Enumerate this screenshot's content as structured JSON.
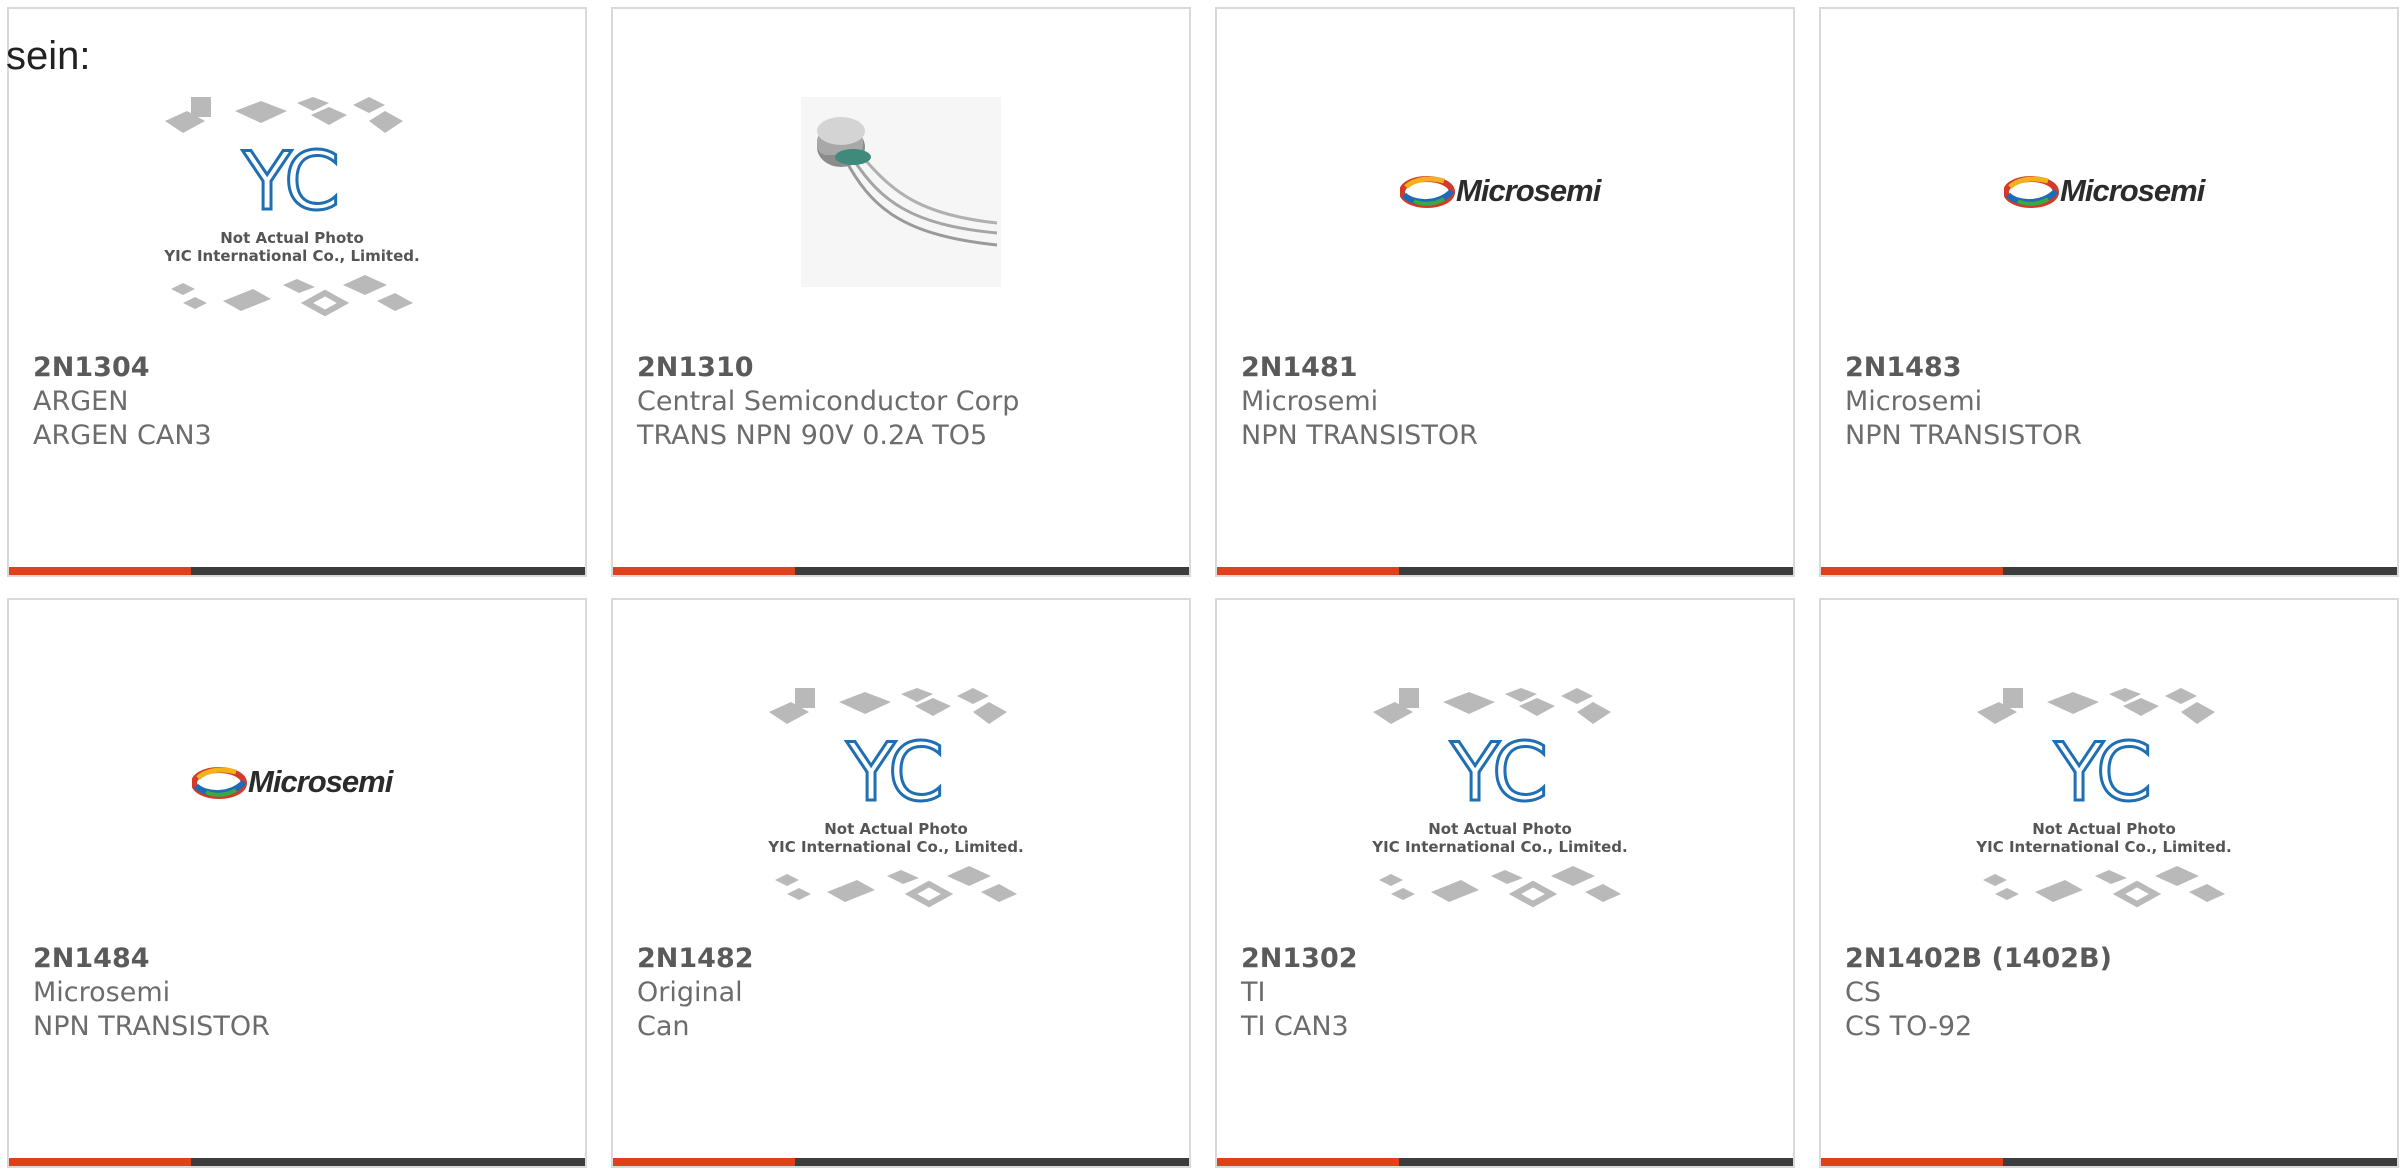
{
  "intro_text": "sein:",
  "colors": {
    "accent": "#e0401c",
    "bar": "#3d3d3d",
    "border": "#d9d9d9"
  },
  "placeholder": {
    "line1": "Not Actual Photo",
    "line2": "YIC International Co., Limited.",
    "logo": "YIC"
  },
  "logo_text": "Microsemi",
  "products": [
    {
      "part": "2N1304",
      "manufacturer": "ARGEN",
      "description": "ARGEN CAN3",
      "image": "placeholder"
    },
    {
      "part": "2N1310",
      "manufacturer": "Central Semiconductor Corp",
      "description": "TRANS NPN 90V 0.2A TO5",
      "image": "transistor-photo"
    },
    {
      "part": "2N1481",
      "manufacturer": "Microsemi",
      "description": "NPN TRANSISTOR",
      "image": "microsemi-logo"
    },
    {
      "part": "2N1483",
      "manufacturer": "Microsemi",
      "description": "NPN TRANSISTOR",
      "image": "microsemi-logo"
    },
    {
      "part": "2N1484",
      "manufacturer": "Microsemi",
      "description": "NPN TRANSISTOR",
      "image": "microsemi-logo"
    },
    {
      "part": "2N1482",
      "manufacturer": "Original",
      "description": "Can",
      "image": "placeholder"
    },
    {
      "part": "2N1302",
      "manufacturer": "TI",
      "description": "TI CAN3",
      "image": "placeholder"
    },
    {
      "part": "2N1402B (1402B)",
      "manufacturer": "CS",
      "description": "CS TO-92",
      "image": "placeholder"
    }
  ]
}
